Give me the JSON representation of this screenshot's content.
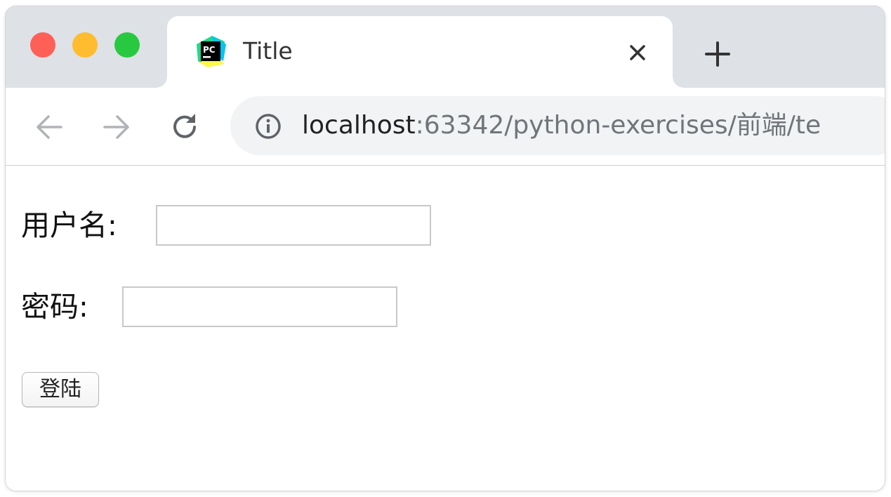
{
  "browser": {
    "tab": {
      "title": "Title",
      "favicon_text": "PC"
    },
    "address_bar": {
      "host": "localhost",
      "rest": ":63342/python-exercises/前端/te"
    }
  },
  "form": {
    "username_label": "用户名:",
    "password_label": "密码:",
    "username_value": "",
    "password_value": "",
    "submit_label": "登陆"
  },
  "icons": {
    "tab_close": "close-icon",
    "new_tab": "plus-icon",
    "back": "back-arrow-icon",
    "forward": "forward-arrow-icon",
    "reload": "reload-icon",
    "site_info": "info-icon"
  },
  "colors": {
    "traffic_close": "#fe5f57",
    "traffic_minimize": "#febc2e",
    "traffic_maximize": "#28c840",
    "titlebar": "#dee1e6",
    "omnibox": "#f1f3f4"
  }
}
